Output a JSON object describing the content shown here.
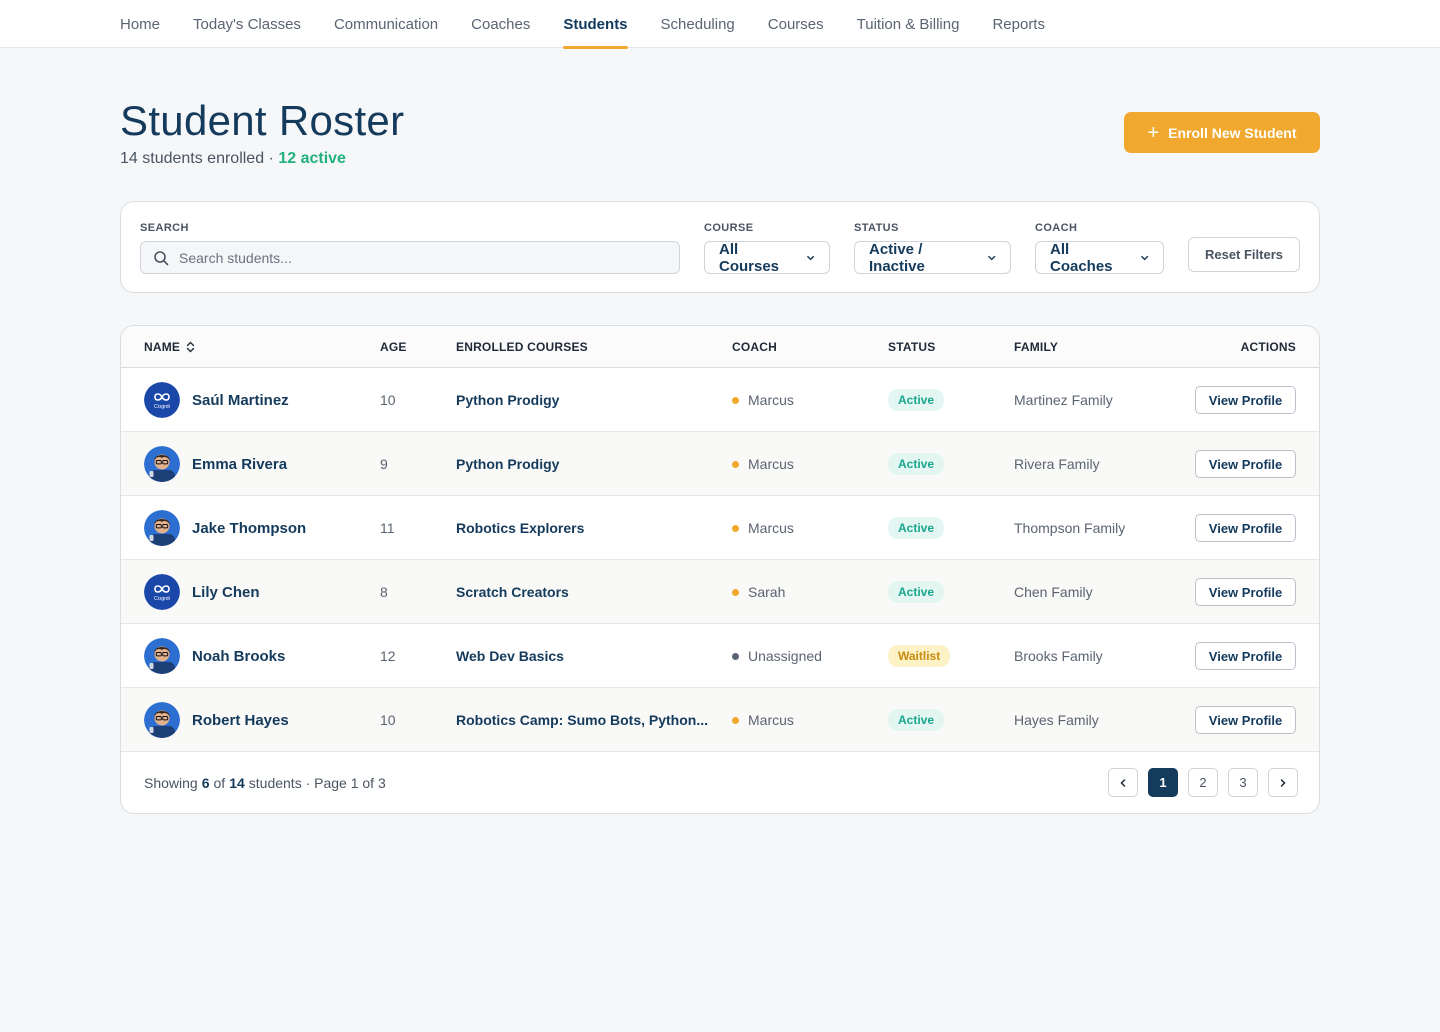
{
  "nav": {
    "items": [
      {
        "label": "Home",
        "active": false
      },
      {
        "label": "Today's Classes",
        "active": false
      },
      {
        "label": "Communication",
        "active": false
      },
      {
        "label": "Coaches",
        "active": false
      },
      {
        "label": "Students",
        "active": true
      },
      {
        "label": "Scheduling",
        "active": false
      },
      {
        "label": "Courses",
        "active": false
      },
      {
        "label": "Tuition & Billing",
        "active": false
      },
      {
        "label": "Reports",
        "active": false
      }
    ]
  },
  "header": {
    "title": "Student Roster",
    "enrolled_text": "14 students enrolled · ",
    "active_text": "12 active",
    "enroll_button_label": "Enroll New Student"
  },
  "filters": {
    "search_label": "SEARCH",
    "search_placeholder": "Search students...",
    "search_value": "",
    "course_label": "COURSE",
    "course_value": "All Courses",
    "status_label": "STATUS",
    "status_value": "Active / Inactive",
    "coach_label": "COACH",
    "coach_value": "All Coaches",
    "reset_label": "Reset Filters"
  },
  "table": {
    "columns": {
      "name": "NAME",
      "age": "AGE",
      "courses": "ENROLLED COURSES",
      "coach": "COACH",
      "status": "STATUS",
      "family": "FAMILY",
      "actions": "ACTIONS"
    },
    "view_label": "View Profile",
    "rows": [
      {
        "name": "Saúl Martinez",
        "avatar": "cognit-logo",
        "age": "10",
        "course": "Python Prodigy",
        "coach": "Marcus",
        "coach_color": "#f0a92e",
        "status": "Active",
        "status_type": "active",
        "family": "Martinez Family"
      },
      {
        "name": "Emma Rivera",
        "avatar": "cartoon-avatar",
        "age": "9",
        "course": "Python Prodigy",
        "coach": "Marcus",
        "coach_color": "#f0a92e",
        "status": "Active",
        "status_type": "active",
        "family": "Rivera Family"
      },
      {
        "name": "Jake Thompson",
        "avatar": "cartoon-avatar",
        "age": "11",
        "course": "Robotics Explorers",
        "coach": "Marcus",
        "coach_color": "#f0a92e",
        "status": "Active",
        "status_type": "active",
        "family": "Thompson Family"
      },
      {
        "name": "Lily Chen",
        "avatar": "cognit-logo",
        "age": "8",
        "course": "Scratch Creators",
        "coach": "Sarah",
        "coach_color": "#f0a92e",
        "status": "Active",
        "status_type": "active",
        "family": "Chen Family"
      },
      {
        "name": "Noah Brooks",
        "avatar": "cartoon-avatar",
        "age": "12",
        "course": "Web Dev Basics",
        "coach": "Unassigned",
        "coach_color": "#5b6472",
        "status": "Waitlist",
        "status_type": "wait",
        "family": "Brooks Family"
      },
      {
        "name": "Robert Hayes",
        "avatar": "cartoon-avatar",
        "age": "10",
        "course": "Robotics Camp: Sumo Bots, Python...",
        "coach": "Marcus",
        "coach_color": "#f0a92e",
        "status": "Active",
        "status_type": "active",
        "family": "Hayes Family"
      }
    ]
  },
  "footer": {
    "showing_prefix": "Showing",
    "shown_count": "6",
    "of_text": "of",
    "total_count": "14",
    "suffix": "students · Page 1 of 3",
    "pages": [
      "1",
      "2",
      "3"
    ],
    "current_page": "1"
  },
  "colors": {
    "brand_navy": "#143a5c",
    "accent_orange": "#f0a92e",
    "active_green": "#22b07d"
  }
}
